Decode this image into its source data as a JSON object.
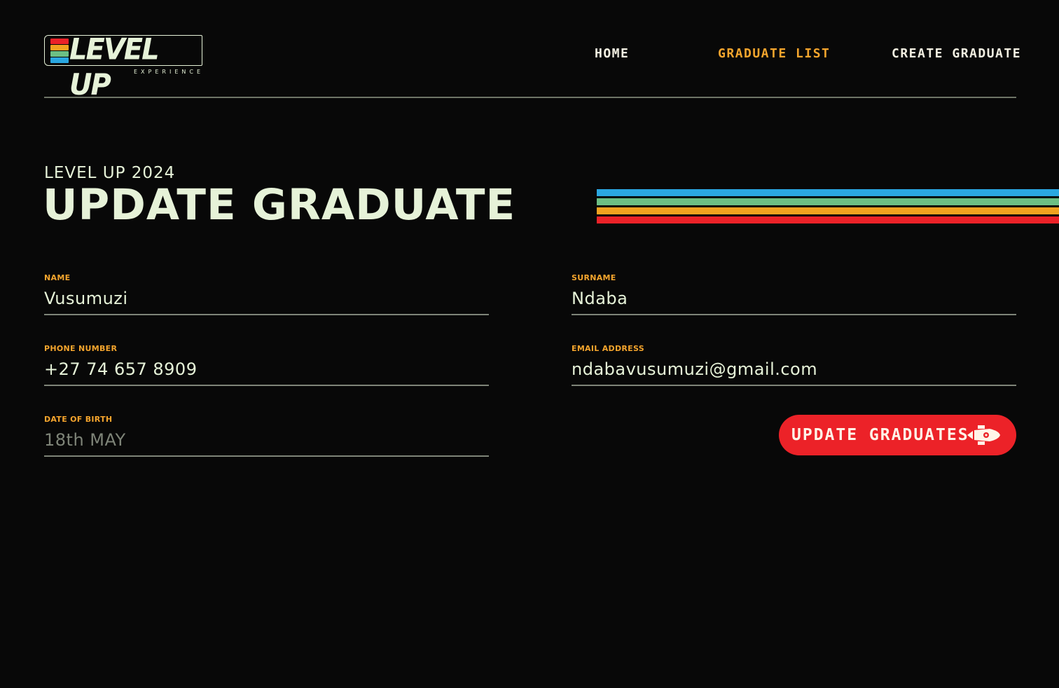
{
  "brand": {
    "logo_text": "LEVEL UP",
    "logo_subtext": "EXPERIENCE",
    "stripe_colors": [
      "#2aa7e1",
      "#6cbf84",
      "#f2a21f",
      "#ec2228"
    ]
  },
  "nav": {
    "items": [
      {
        "label": "HOME",
        "active": false
      },
      {
        "label": "GRADUATE LIST",
        "active": true
      },
      {
        "label": "CREATE GRADUATE",
        "active": false
      }
    ]
  },
  "hero": {
    "eyebrow": "LEVEL UP 2024",
    "title": "UPDATE GRADUATE"
  },
  "form": {
    "name": {
      "label": "NAME",
      "value": "Vusumuzi"
    },
    "surname": {
      "label": "SURNAME",
      "value": "Ndaba"
    },
    "phone": {
      "label": "PHONE NUMBER",
      "value": "+27 74 657 8909"
    },
    "email": {
      "label": "EMAIL ADDRESS",
      "value": "ndabavusumuzi@gmail.com"
    },
    "dob": {
      "label": "DATE OF BIRTH",
      "placeholder": "18th MAY"
    },
    "submit_label": "UPDATE GRADUATES",
    "submit_icon": "rocket-icon"
  },
  "colors": {
    "background": "#080808",
    "text": "#e6f2d8",
    "accent": "#f5a52d",
    "button": "#ec2228"
  }
}
